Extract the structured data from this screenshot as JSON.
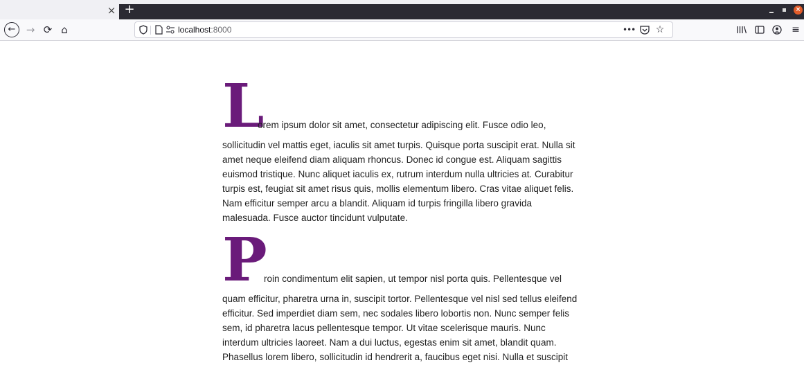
{
  "tab_bar": {
    "close_glyph": "×",
    "new_tab_glyph": "+",
    "window_close_glyph": "×"
  },
  "toolbar": {
    "back_glyph": "←",
    "forward_glyph": "→",
    "reload_glyph": "⟳",
    "home_glyph": "⌂",
    "url_host": "localhost",
    "url_port": ":8000",
    "dots_glyph": "•••",
    "pocket_glyph": "◡",
    "star_glyph": "☆",
    "library_glyph": "|||\\",
    "sidebar_glyph": "◫",
    "account_glyph": "◉",
    "menu_glyph": "≡"
  },
  "icons": {
    "back": "arrow-left-icon",
    "forward": "arrow-right-icon",
    "reload": "reload-icon",
    "home": "home-icon",
    "shield": "shield-icon",
    "page": "page-icon",
    "permissions": "permissions-icon",
    "more": "more-icon",
    "pocket": "pocket-icon",
    "bookmark": "star-icon",
    "library": "library-icon",
    "sidebar": "sidebar-icon",
    "account": "account-icon",
    "menu": "hamburger-icon"
  },
  "colors": {
    "dropcap": "#6a1b7a",
    "tabbar_dark": "#2b2a33",
    "window_close": "#e25c2a"
  },
  "article": {
    "paragraphs": [
      {
        "dropcap": "L",
        "first_line": "orem ipsum dolor sit amet, consectetur adipiscing elit. Fusce odio leo,",
        "rest": "sollicitudin vel mattis eget, iaculis sit amet turpis. Quisque porta suscipit erat. Nulla sit amet neque eleifend diam aliquam rhoncus. Donec id congue est. Aliquam sagittis euismod tristique. Nunc aliquet iaculis ex, rutrum interdum nulla ultricies at. Curabitur turpis est, feugiat sit amet risus quis, mollis elementum libero. Cras vitae aliquet felis. Nam efficitur semper arcu a blandit. Aliquam id turpis fringilla libero gravida malesuada. Fusce auctor tincidunt vulputate."
      },
      {
        "dropcap": "P",
        "first_line": "roin condimentum elit sapien, ut tempor nisl porta quis. Pellentesque vel",
        "rest": "quam efficitur, pharetra urna in, suscipit tortor. Pellentesque vel nisl sed tellus eleifend efficitur. Sed imperdiet diam sem, nec sodales libero lobortis non. Nunc semper felis sem, id pharetra lacus pellentesque tempor. Ut vitae scelerisque mauris. Nunc interdum ultricies laoreet. Nam a dui luctus, egestas enim sit amet, blandit quam. Phasellus lorem libero, sollicitudin id hendrerit a, faucibus eget nisi. Nulla et suscipit felis. Phasellus auctor nisi leo, a bibendum turpis convallis nec."
      }
    ]
  }
}
